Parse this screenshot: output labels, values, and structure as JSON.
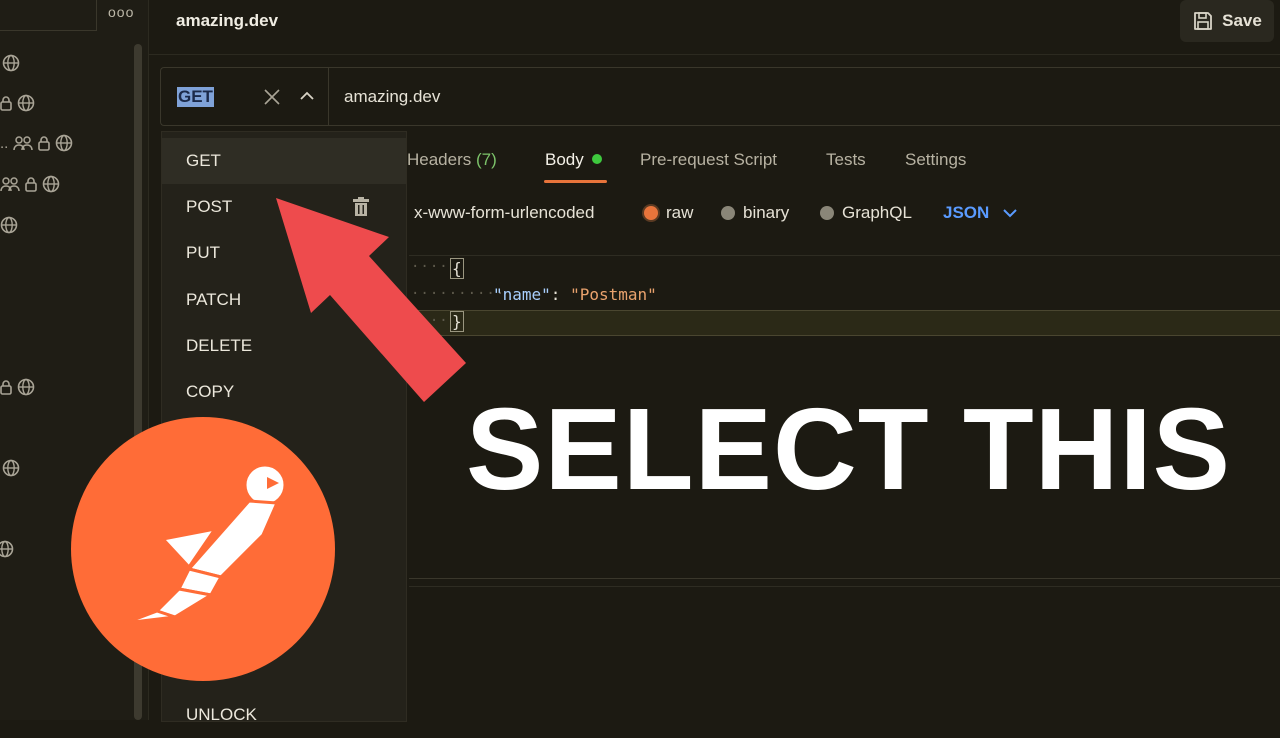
{
  "header": {
    "tab_title": "amazing.dev",
    "save_label": "Save"
  },
  "sidebar": {
    "more_label": "ooo",
    "ellipsis": ".."
  },
  "request": {
    "method": "GET",
    "url": "amazing.dev",
    "tabs": [
      {
        "label": "Headers",
        "count": "(7)"
      },
      {
        "label": "Body"
      },
      {
        "label": "Pre-request Script"
      },
      {
        "label": "Tests"
      },
      {
        "label": "Settings"
      }
    ],
    "body_types": [
      {
        "label": "x-www-form-urlencoded"
      },
      {
        "label": "raw",
        "selected": true
      },
      {
        "label": "binary"
      },
      {
        "label": "GraphQL"
      }
    ],
    "format": "JSON"
  },
  "editor": {
    "open_brace": "{",
    "key": "\"name\"",
    "colon": ":",
    "value": "\"Postman\"",
    "close_brace": "}"
  },
  "method_menu": {
    "items": [
      "GET",
      "POST",
      "PUT",
      "PATCH",
      "DELETE",
      "COPY",
      "UNLOCK"
    ]
  },
  "overlay": {
    "caption": "SELECT THIS"
  },
  "colors": {
    "accent": "#e8743b",
    "logo": "#ff6c37",
    "arrow": "#ee4b4d",
    "link": "#5a9bff"
  }
}
